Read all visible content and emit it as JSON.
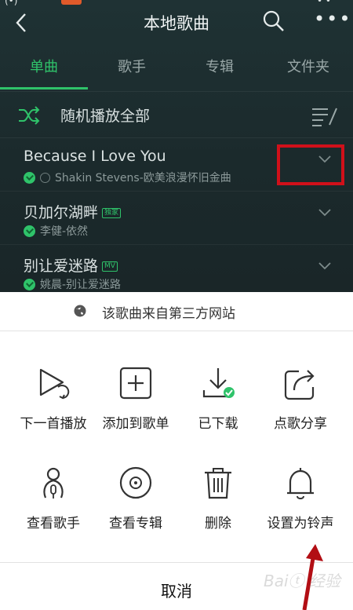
{
  "statusbar": {
    "left_glyphs": "(•)",
    "right_glyphs": "• •"
  },
  "header": {
    "title": "本地歌曲",
    "more_label": "•••"
  },
  "tabs": [
    {
      "label": "单曲",
      "active": true
    },
    {
      "label": "歌手",
      "active": false
    },
    {
      "label": "专辑",
      "active": false
    },
    {
      "label": "文件夹",
      "active": false
    }
  ],
  "shuffle": {
    "label": "随机播放全部"
  },
  "songs": [
    {
      "title": "Because I Love You",
      "subtitle": "Shakin Stevens-欧美浪漫怀旧金曲",
      "tag": ""
    },
    {
      "title": "贝加尔湖畔",
      "subtitle": "李健-依然",
      "tag": "独家"
    },
    {
      "title": "别让爱迷路",
      "subtitle": "姚晨-别让爱迷路",
      "tag": "MV"
    }
  ],
  "sheet": {
    "source_text": "该歌曲来自第三方网站",
    "actions": [
      {
        "label": "下一首播放",
        "icon": "play-next-icon"
      },
      {
        "label": "添加到歌单",
        "icon": "add-to-playlist-icon"
      },
      {
        "label": "已下载",
        "icon": "downloaded-icon"
      },
      {
        "label": "点歌分享",
        "icon": "share-icon"
      },
      {
        "label": "查看歌手",
        "icon": "singer-icon"
      },
      {
        "label": "查看专辑",
        "icon": "album-icon"
      },
      {
        "label": "删除",
        "icon": "trash-icon"
      },
      {
        "label": "设置为铃声",
        "icon": "bell-icon"
      }
    ],
    "cancel_label": "取消"
  },
  "watermark": "Baiⓣ 经验",
  "colors": {
    "accent": "#2fc36a",
    "annotation": "#d0101a",
    "background_dark": "#1c2a2c"
  }
}
